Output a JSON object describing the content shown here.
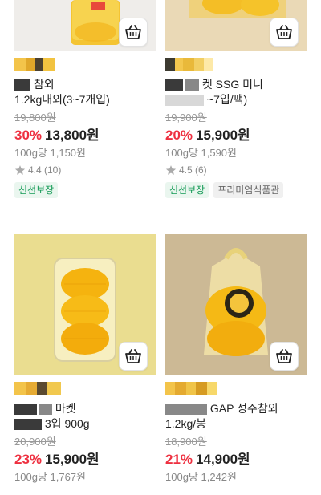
{
  "colors": {
    "discount": "#ee3040",
    "fresh": "#139a55",
    "muted": "#999999"
  },
  "products": [
    {
      "name_line1": "참외",
      "name_line2": "1.2kg내외(3~7개입)",
      "original_price": "19,800원",
      "discount": "30%",
      "price": "13,800원",
      "unit_price": "100g당 1,150원",
      "rating": "4.4 (10)",
      "badges": [
        "신선보장"
      ],
      "cart_icon": "cart-icon"
    },
    {
      "name_line1": "켓 SSG 미니",
      "name_line2": "~7입/팩)",
      "original_price": "19,900원",
      "discount": "20%",
      "price": "15,900원",
      "unit_price": "100g당 1,590원",
      "rating": "4.5 (6)",
      "badges": [
        "신선보장",
        "프리미엄식품관"
      ],
      "cart_icon": "cart-icon"
    },
    {
      "name_line1": "마켓",
      "name_line2": "3입 900g",
      "original_price": "20,900원",
      "discount": "23%",
      "price": "15,900원",
      "unit_price": "100g당 1,767원",
      "cart_icon": "cart-icon"
    },
    {
      "name_line1": "GAP 성주참외",
      "name_line2": "1.2kg/봉",
      "original_price": "18,900원",
      "discount": "21%",
      "price": "14,900원",
      "unit_price": "100g당 1,242원",
      "cart_icon": "cart-icon"
    }
  ]
}
